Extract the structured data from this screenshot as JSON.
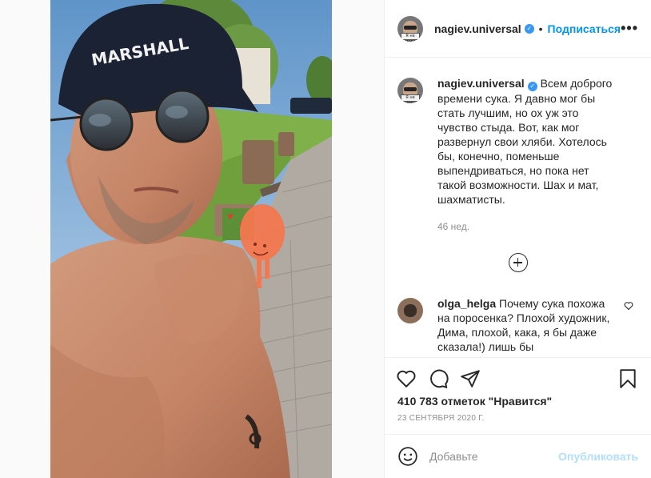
{
  "post": {
    "author": "nagiev.universal",
    "follow_label": "Подписаться",
    "more_label": "•••",
    "dot": "•",
    "verified_mark": "✓",
    "avatar_sign_text": "Я не могу"
  },
  "caption": {
    "username": "nagiev.universal",
    "text": "Всем доброго времени сука. Я давно мог бы стать лучшим, но ох уж это чувство стыда. Вот, как мог развернул свои хляби. Хотелось бы, конечно, поменьше выпендриваться, но пока нет такой возможности. Шах и мат, шахматисты.",
    "time": "46 нед."
  },
  "comments": [
    {
      "username": "olga_helga",
      "text": "Почему сука похожа на поросенка? Плохой художник, Дима, плохой, кака, я бы даже сказала!) лишь бы"
    }
  ],
  "photo": {
    "cap_text": "FRANKLIN AND MARSHALL"
  },
  "stats": {
    "likes": "410 783 отметок \"Нравится\"",
    "date": "23 СЕНТЯБРЯ 2020 Г."
  },
  "add_comment": {
    "placeholder": "Добавьте",
    "publish_label": "Опубликовать"
  },
  "icons": {
    "like": "heart-icon",
    "comment": "comment-icon",
    "share": "share-icon",
    "save": "bookmark-icon",
    "emoji": "emoji-icon",
    "load_more": "plus-circle-icon",
    "comment_like": "heart-icon"
  },
  "colors": {
    "accent": "#0095f6",
    "verified": "#3897f0",
    "publish_disabled": "#b2dffc",
    "muted": "#8e8e8e"
  }
}
